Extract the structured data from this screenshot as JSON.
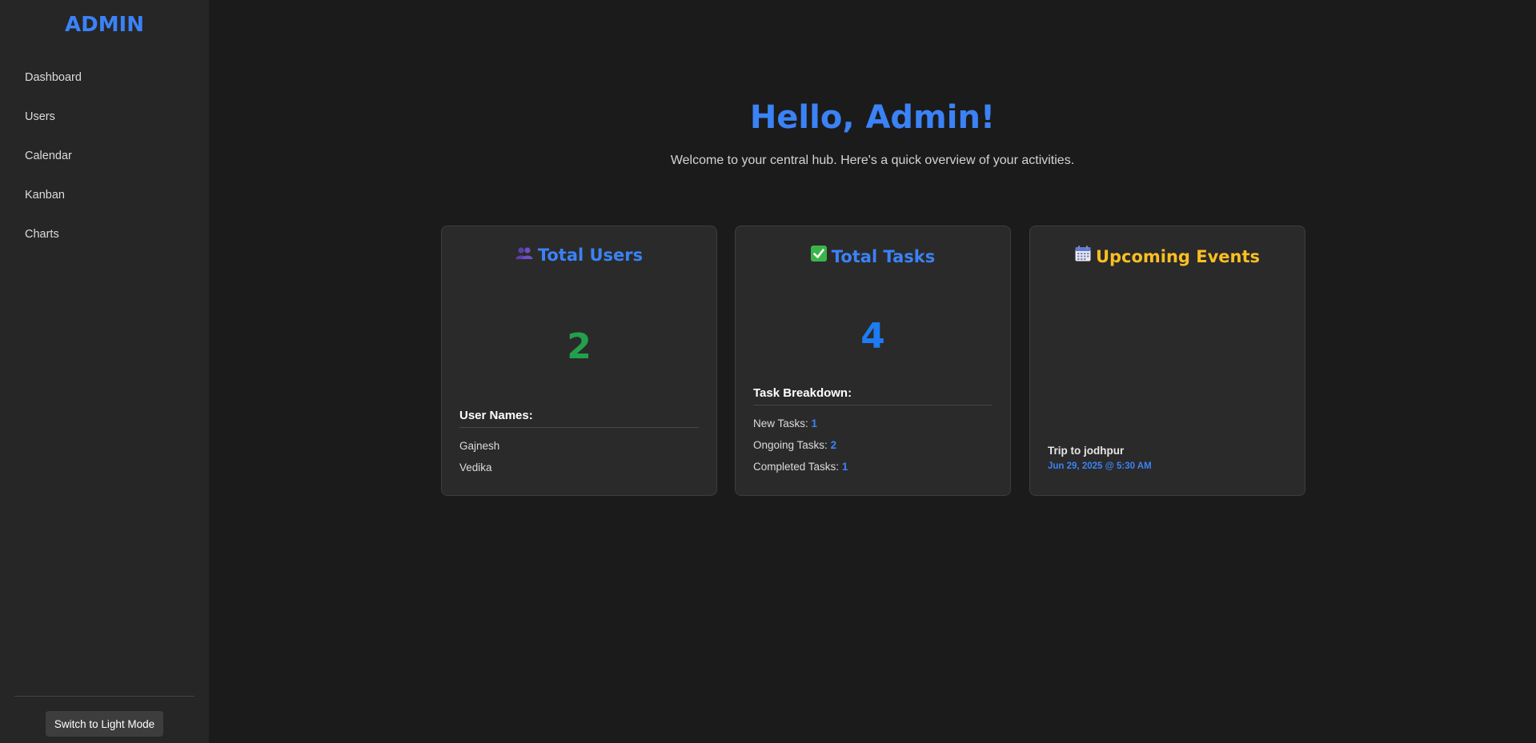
{
  "sidebar": {
    "brand": "ADMIN",
    "items": [
      {
        "label": "Dashboard"
      },
      {
        "label": "Users"
      },
      {
        "label": "Calendar"
      },
      {
        "label": "Kanban"
      },
      {
        "label": "Charts"
      }
    ],
    "theme_button": "Switch to Light Mode"
  },
  "header": {
    "title": "Hello, Admin!",
    "subtitle": "Welcome to your central hub. Here's a quick overview of your activities."
  },
  "cards": {
    "users": {
      "icon": "users-icon",
      "title": "Total Users",
      "count": "2",
      "count_color": "#22a04b",
      "list_heading": "User Names:",
      "names": [
        "Gajnesh",
        "Vedika"
      ]
    },
    "tasks": {
      "icon": "checkbox-icon",
      "title": "Total Tasks",
      "count": "4",
      "count_color": "#1d7cf2",
      "breakdown_heading": "Task Breakdown:",
      "breakdown": [
        {
          "label": "New Tasks:",
          "value": "1"
        },
        {
          "label": "Ongoing Tasks:",
          "value": "2"
        },
        {
          "label": "Completed Tasks:",
          "value": "1"
        }
      ]
    },
    "events": {
      "icon": "calendar-icon",
      "title": "Upcoming Events",
      "title_color": "#fbbf24",
      "items": [
        {
          "title": "Trip to jodhpur",
          "date": "Jun 29, 2025 @ 5:30 AM"
        }
      ]
    }
  },
  "colors": {
    "accent": "#3b82f6",
    "background": "#1b1b1b",
    "sidebar": "#262626",
    "card": "#2a2a2a"
  }
}
